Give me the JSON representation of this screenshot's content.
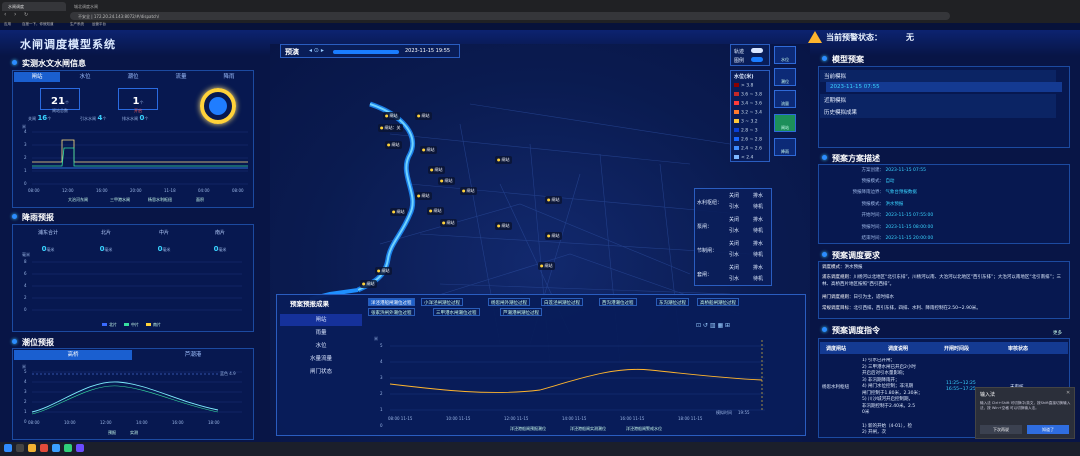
{
  "browser": {
    "tabs": [
      "水闸调度",
      "城北调度水闸"
    ],
    "address": "不安全 | 172.20.24.143:8072/#/dispatch/",
    "bookmarks": [
      "应用",
      "百度一下，你就知道",
      "生产系统",
      "运营平台"
    ]
  },
  "app": {
    "title": "水闸调度模型系统",
    "banner_label": "当前预警状态：",
    "banner_value": "无"
  },
  "left": {
    "hydro_title": "实测水文水闸信息",
    "hydro_tabs": [
      "闸站",
      "水位",
      "潮位",
      "流量",
      "降雨"
    ],
    "gate_open_num": "21",
    "gate_open_unit": "个",
    "gate_open_label": "闸站总数",
    "gate_closed_num": "1",
    "gate_closed_unit": "个",
    "gate_closed_label": "开启",
    "counts": [
      {
        "label": "关闸",
        "value": "16",
        "unit": "个"
      },
      {
        "label": "引水水闸",
        "value": "4",
        "unit": "个"
      },
      {
        "label": "排水水闸",
        "value": "0",
        "unit": "个"
      }
    ],
    "gauge_label": "42%",
    "chart1": {
      "ylabel": "米",
      "yticks": [
        "4",
        "3",
        "2",
        "1",
        "0"
      ],
      "xticks": [
        "08:00",
        "12:00",
        "16:00",
        "20:00",
        "11-18",
        "04:00",
        "08:00"
      ],
      "legend": [
        "大治河东闸",
        "三甲港水闸",
        "杨思水利枢纽",
        "面积"
      ]
    },
    "rain_title": "降雨预报",
    "rain_cols": [
      {
        "label": "浦东合计",
        "value": "0",
        "unit": "毫米"
      },
      {
        "label": "北片",
        "value": "0",
        "unit": "毫米"
      },
      {
        "label": "中片",
        "value": "0",
        "unit": "毫米"
      },
      {
        "label": "南片",
        "value": "0",
        "unit": "毫米"
      }
    ],
    "rain_chart": {
      "ylabel": "毫米",
      "yticks": [
        "8",
        "6",
        "4",
        "2",
        "0"
      ],
      "legend": [
        "北片",
        "中片",
        "南片"
      ]
    },
    "tide_title": "潮位预报",
    "tide_tabs": [
      "高桥",
      "芦潮港"
    ],
    "tide_chart": {
      "ylabel": "米",
      "yticks": [
        "5",
        "4",
        "3",
        "2",
        "1",
        "0"
      ],
      "xticks": [
        "08:00",
        "10:00",
        "12:00",
        "14:00",
        "16:00",
        "18:00"
      ],
      "warn_label": "蓝色 4.9",
      "legend": [
        "预报",
        "实测"
      ]
    }
  },
  "map": {
    "label": "预演",
    "time": "2023-11-15 19:55",
    "markers": [
      "闸站",
      "闸站",
      "闸站：关",
      "闸站",
      "闸站",
      "闸站",
      "闸站",
      "闸站",
      "闸站",
      "闸站",
      "闸站",
      "闸站",
      "闸站",
      "闸站",
      "闸站",
      "闸站",
      "闸站",
      "闸站",
      "闸站"
    ],
    "toggles": [
      "轨迹",
      "图例"
    ],
    "water_legend_title": "水位(米)",
    "water_legend": [
      {
        "label": "> 3.8",
        "color": "#8b0000"
      },
      {
        "label": "3.6 ~ 3.8",
        "color": "#c62828"
      },
      {
        "label": "3.4 ~ 3.6",
        "color": "#ff3b3b"
      },
      {
        "label": "3.2 ~ 3.4",
        "color": "#ff7a2e"
      },
      {
        "label": "3 ~ 3.2",
        "color": "#ffc93a"
      },
      {
        "label": "2.8 ~ 3",
        "color": "#0a3fd6"
      },
      {
        "label": "2.6 ~ 2.8",
        "color": "#1765ff"
      },
      {
        "label": "2.4 ~ 2.6",
        "color": "#3f8cff"
      },
      {
        "label": "< 2.4",
        "color": "#7fb8ff"
      }
    ],
    "view_buttons": [
      "水位",
      "潮位",
      "流量",
      "闸站",
      "降雨"
    ],
    "gate_legend": [
      {
        "group": "水利枢纽：",
        "items": [
          "关闭",
          "排水",
          "引水",
          "待机"
        ]
      },
      {
        "group": "泵闸：",
        "items": [
          "关闭",
          "排水",
          "引水",
          "待机"
        ]
      },
      {
        "group": "节制闸：",
        "items": [
          "关闭",
          "排水",
          "引水",
          "待机"
        ]
      },
      {
        "group": "套闸：",
        "items": [
          "关闭",
          "排水",
          "引水",
          "待机"
        ]
      }
    ]
  },
  "forecast": {
    "title": "预案预报成果",
    "menu": [
      "闸站",
      "雨量",
      "水位",
      "水量流量",
      "闸门状态"
    ],
    "station_tabs": [
      "洋泾港船闸潮位过程",
      "小洋泾闸潮位过程",
      "杨思闸外潮位过程",
      "白莲泾闸潮位过程",
      "西沟港潮位过程",
      "东沟潮位过程",
      "高桥船闸潮位过程",
      "张家浜闸外潮位过程",
      "三甲港水闸潮位过程",
      "芦潮港闸潮位过程"
    ],
    "chart": {
      "ylabel": "米",
      "yticks": [
        "5",
        "4",
        "3",
        "2",
        "1",
        "0"
      ],
      "xticks": [
        "08:00\n11-15",
        "10:00\n11-15",
        "12:00\n11-15",
        "14:00\n11-15",
        "16:00\n11-15",
        "18:00\n11-15",
        "19:55"
      ],
      "current_label": "模拟时间",
      "legend": [
        "洋泾港船闸预报潮位",
        "洋泾港船闸实测潮位",
        "洋泾港船闸警戒水位"
      ]
    }
  },
  "right": {
    "plan_title": "模型预案",
    "plans": [
      "当前模拟",
      "2023-11-15 07:55",
      "近期模拟",
      "历史模拟成果"
    ],
    "desc_title": "预案方案描述",
    "desc": [
      {
        "k": "方案创建：",
        "v": "2023-11-15 07:55"
      },
      {
        "k": "预报模式：",
        "v": "自动"
      },
      {
        "k": "预报降雨边界：",
        "v": "气象台预报数据"
      },
      {
        "k": "预报模式：",
        "v": "洪水预报"
      },
      {
        "k": "开始时间：",
        "v": "2023-11-15 07:55:00"
      },
      {
        "k": "预报时间：",
        "v": "2023-11-15 08:00:00"
      },
      {
        "k": "结束时间：",
        "v": "2023-11-15 20:00:00"
      }
    ],
    "req_title": "预案调度要求",
    "req": [
      {
        "k": "调度模式：",
        "v": "洪水预报"
      },
      {
        "k": "浦东调度规则：",
        "v": "川杨河以北地区“北引东排”，川杨河以南、大治河以北地区“西引东排”；大治河以南地区“北引南排”；三林、高桥西片地区按照“西引西排”。"
      },
      {
        "k": "闸门调度规则：",
        "v": "日引为主，适时排水"
      },
      {
        "k": "常规调度目标：",
        "v": "北引西排，西引东排，四排、水利、降雨控制在2.50~2.90米。"
      }
    ],
    "cmd_title": "预案调度指令",
    "more": "更多",
    "cmd_headers": [
      "调度闸站",
      "调度说明",
      "开闸时间段",
      "审核状态"
    ],
    "cmd_row": {
      "station": "杨思水利枢纽",
      "desc": "1) 引水已开闸；\n2) 三甲港水闸已开启2小时\n开启后对引水量影响；\n3) 非汛期降雨开；\n4) 闸门水位控制；非汛期\n闸门控制于1.80米，2.30米；\n5) 川沙城河开启控制期，\n非汛期控制于2.40米。2.5\n0米",
      "time": "11:25~12:25\n16:55~17:25",
      "status": "未审核",
      "desc2": "1) 新的开始（4-01），检\n2) 开闸，次"
    }
  },
  "toast": {
    "title": "输入法",
    "text": "输入法 Ctrl+Shift 可切换中/英文，按Shift直接切换输入法，按 Win+空格 可以切换输入法。",
    "btn1": "下次再说",
    "btn2": "知道了"
  }
}
